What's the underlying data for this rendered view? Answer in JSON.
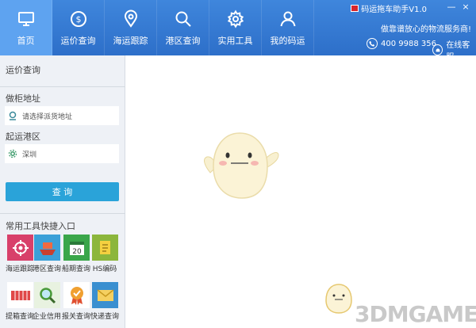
{
  "nav": {
    "items": [
      {
        "label": "首页",
        "icon": "monitor-icon"
      },
      {
        "label": "运价查询",
        "icon": "dollar-icon"
      },
      {
        "label": "海运跟踪",
        "icon": "location-pin-icon"
      },
      {
        "label": "港区查询",
        "icon": "search-icon"
      },
      {
        "label": "实用工具",
        "icon": "gear-icon"
      },
      {
        "label": "我的码运",
        "icon": "user-icon"
      }
    ],
    "active_index": 0
  },
  "header": {
    "app_title": "码运拖车助手V1.0",
    "minimize": "—",
    "close": "×",
    "slogan": "做靠谱放心的物流服务商!",
    "phone": "400 9988 356",
    "support": "在线客服"
  },
  "sidebar": {
    "freight_title": "运价查询",
    "pickup_title": "做柜地址",
    "pickup_placeholder": "请选择派货地址",
    "origin_title": "起运港区",
    "origin_value": "深圳",
    "query_button": "查 询",
    "tools_title": "常用工具快捷入口",
    "tools": [
      {
        "label": "海运跟踪",
        "icon": "target-icon",
        "color": "#d8406a"
      },
      {
        "label": "港区查询",
        "icon": "ship-icon",
        "color": "#3aa0d8"
      },
      {
        "label": "船期查询",
        "icon": "calendar-icon",
        "color": "#3aa64a"
      },
      {
        "label": "HS编码",
        "icon": "document-icon",
        "color": "#8cb63c"
      },
      {
        "label": "提箱查询",
        "icon": "container-icon",
        "color": "#e04848"
      },
      {
        "label": "企业信用",
        "icon": "magnifier-icon",
        "color": "#5cb85c"
      },
      {
        "label": "报关查询",
        "icon": "badge-icon",
        "color": "#f0a030"
      },
      {
        "label": "快递查询",
        "icon": "envelope-icon",
        "color": "#3a8fd0"
      }
    ]
  },
  "watermark": "3DMGAME",
  "colors": {
    "nav": "#2d6fc9",
    "nav_active": "#5ea3f0",
    "button": "#2aa3d9",
    "sidebar": "#eef1f6"
  }
}
